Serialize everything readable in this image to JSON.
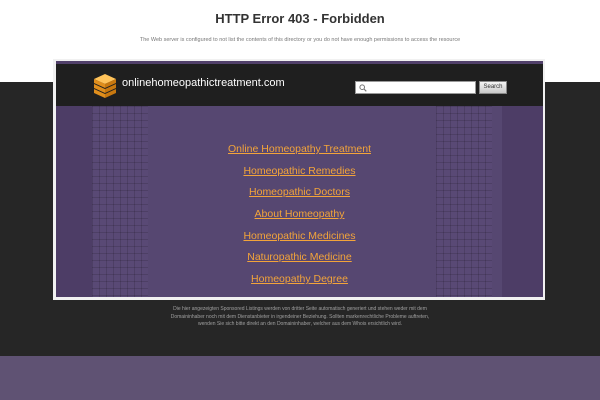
{
  "error": {
    "title": "HTTP Error 403 - Forbidden",
    "message": "The Web server is configured to not list the contents of this directory or you do not have enough permissions to access the resource"
  },
  "header": {
    "site_name": "onlinehomeopathictreatment.com",
    "search_placeholder": "",
    "search_button": "Search"
  },
  "links": [
    "Online Homeopathy Treatment",
    "Homeopathic Remedies",
    "Homeopathic Doctors",
    "About Homeopathy",
    "Homeopathic Medicines",
    "Naturopathic Medicine",
    "Homeopathy Degree"
  ],
  "disclaimer": "Die hier angezeigten Sponsored Listings werden von dritter Seite automatisch generiert und stehen weder mit dem Domaininhaber noch mit dem Dienstanbieter in irgendeiner Beziehung. Sollten markenrechtliche Probleme auftreten, wenden Sie sich bitte direkt an den Domaininhaber, welcher aus dem Whois ersichtlich wird.",
  "colors": {
    "link": "#f3a43a",
    "panel": "#4d3d66",
    "header": "#1f1f1f",
    "dark_band": "#262626",
    "footer_band": "#5f5273",
    "logo": "#f0a531"
  },
  "icons": {
    "logo": "stacked-boxes-icon",
    "search": "magnifier-icon"
  }
}
